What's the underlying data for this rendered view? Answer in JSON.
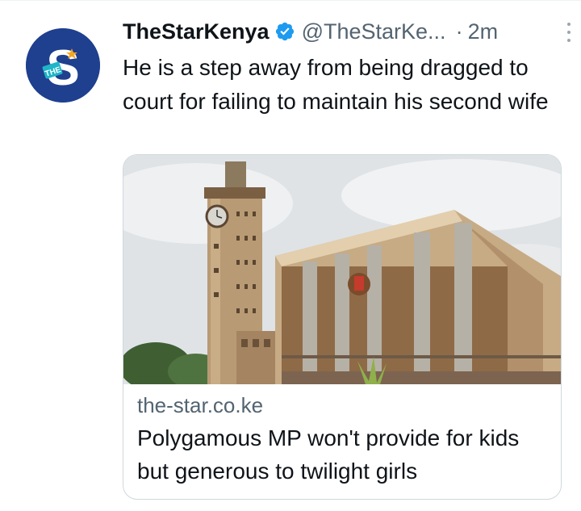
{
  "tweet": {
    "display_name": "TheStarKenya",
    "handle": "@TheStarKe...",
    "separator": "·",
    "timestamp": "2m",
    "text": "He is a step away from being dragged to court for failing to maintain his second wife",
    "avatar_icon": "the-star-logo-icon",
    "verified_icon": "verified-badge-icon",
    "more_icon": "more-options-icon",
    "colors": {
      "avatar_bg": "#1f3f8f",
      "verified": "#1d9bf0",
      "secondary_text": "#536471"
    }
  },
  "card": {
    "image_desc_icon": "parliament-building-image",
    "domain": "the-star.co.ke",
    "title": "Polygamous MP won't provide for kids but generous to twilight girls"
  }
}
